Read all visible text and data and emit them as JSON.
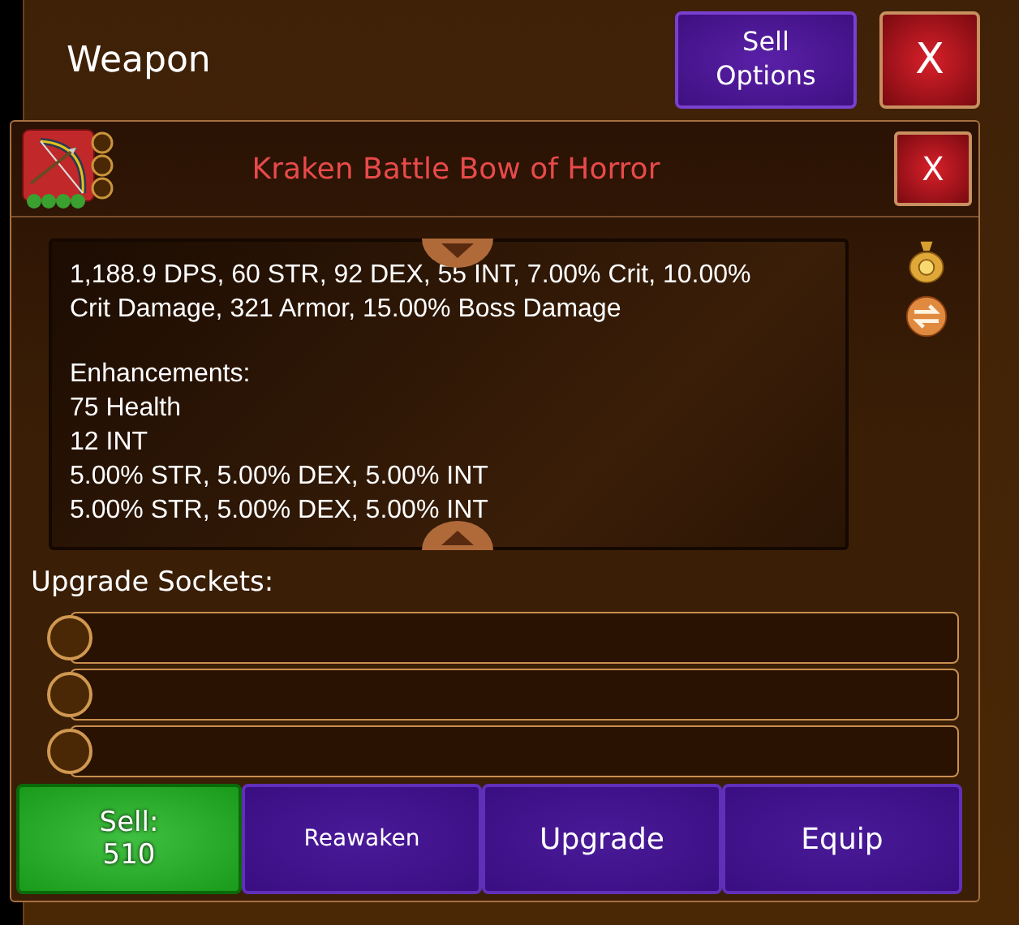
{
  "window": {
    "title": "Weapon",
    "buttons": [
      {
        "label": "Sell\nOptions",
        "kind": "purple"
      },
      {
        "label": "X",
        "kind": "red"
      }
    ]
  },
  "item": {
    "name": "Kraken Battle Bow of Horror",
    "close": "X",
    "stats": "1,188.9 DPS, 60 STR, 92 DEX, 55 INT, 7.00% Crit, 10.00% Crit Damage, 321 Armor, 15.00% Boss Damage",
    "enhancements_heading": "Enhancements:",
    "enhancements": [
      "75 Health",
      "12 INT",
      "5.00% STR, 5.00% DEX, 5.00% INT",
      "5.00% STR, 5.00% DEX, 5.00% INT"
    ]
  },
  "sockets": {
    "title": "Upgrade Sockets:",
    "slots": [
      {
        "kind": "empty"
      },
      {
        "kind": "empty"
      },
      {
        "kind": "empty"
      }
    ]
  },
  "actions": [
    {
      "kind": "sell",
      "label": "Sell:",
      "price": "510"
    },
    {
      "kind": "action",
      "label": "Reawaken",
      "small": true
    },
    {
      "kind": "action",
      "label": "Upgrade",
      "small": false
    },
    {
      "kind": "action",
      "label": "Equip",
      "small": false
    }
  ]
}
